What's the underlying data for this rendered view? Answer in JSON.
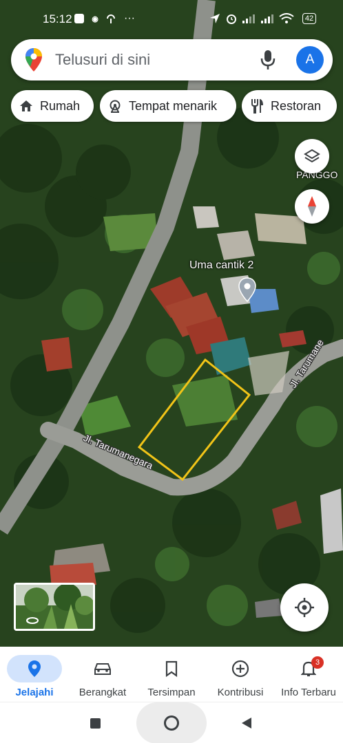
{
  "status_bar": {
    "time": "15:12",
    "battery": "42"
  },
  "search": {
    "placeholder": "Telusuri di sini",
    "avatar_letter": "A"
  },
  "chips": [
    {
      "label": "Rumah",
      "icon": "home-icon"
    },
    {
      "label": "Tempat menarik",
      "icon": "ferris-wheel-icon"
    },
    {
      "label": "Restoran",
      "icon": "restaurant-icon"
    }
  ],
  "map": {
    "labels": {
      "area": "PANGGO",
      "place": "Uma cantik 2",
      "road_main": "Jl. Tarumanegara",
      "road_side": "Jl. Tarumane"
    },
    "colors": {
      "parcel_outline": "#f2c418",
      "road": "#9a9c96",
      "accent": "#1a73e8"
    }
  },
  "bottom_nav": {
    "items": [
      {
        "label": "Jelajahi",
        "icon": "location-pin-icon",
        "active": true
      },
      {
        "label": "Berangkat",
        "icon": "car-icon",
        "active": false
      },
      {
        "label": "Tersimpan",
        "icon": "bookmark-icon",
        "active": false
      },
      {
        "label": "Kontribusi",
        "icon": "add-circle-icon",
        "active": false
      },
      {
        "label": "Info Terbaru",
        "icon": "bell-icon",
        "active": false,
        "badge": "3"
      }
    ]
  },
  "system_nav": {
    "buttons": [
      "recents-button",
      "home-button",
      "back-button"
    ]
  }
}
